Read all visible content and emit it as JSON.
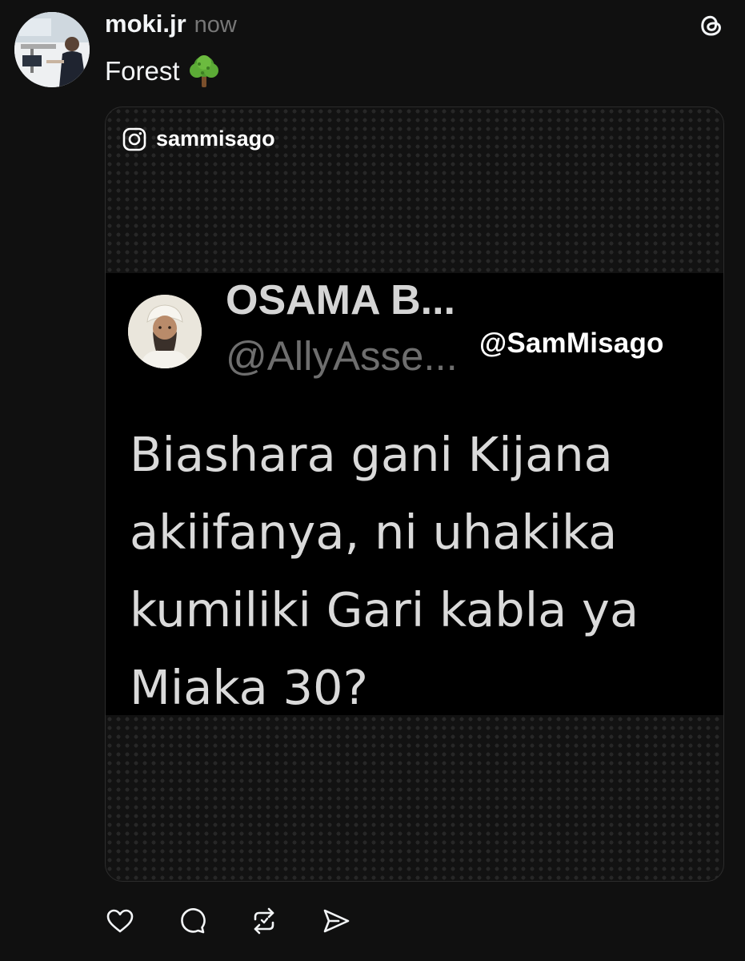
{
  "post": {
    "author": "moki.jr",
    "timestamp": "now",
    "caption": "Forest",
    "caption_emoji": "deciduous-tree-emoji"
  },
  "media": {
    "source_icon": "instagram-icon",
    "source_handle": "sammisago",
    "tweet": {
      "name": "OSAMA B...",
      "handle": "@AllyAsse...",
      "watermark": "@SamMisago",
      "lines": [
        "Biashara gani Kijana",
        "akiifanya, ni uhakika",
        "kumiliki Gari kabla ya",
        "Miaka 30?"
      ]
    }
  },
  "actions": {
    "icons": [
      "heart-icon",
      "comment-icon",
      "repost-icon",
      "share-icon"
    ]
  },
  "colors": {
    "background": "#101010",
    "text_primary": "#f3f5f7",
    "text_secondary": "#777777",
    "tweet_body": "#dadada"
  }
}
